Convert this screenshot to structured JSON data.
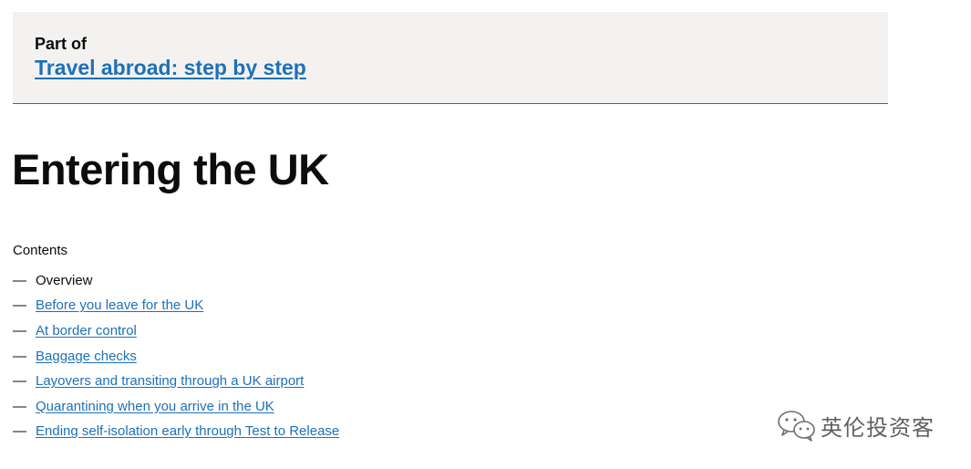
{
  "part_of": {
    "label": "Part of",
    "link_text": "Travel abroad: step by step"
  },
  "title": "Entering the UK",
  "contents": {
    "heading": "Contents",
    "dash": "—",
    "items": [
      {
        "label": "Overview",
        "current": true
      },
      {
        "label": "Before you leave for the UK",
        "current": false
      },
      {
        "label": "At border control",
        "current": false
      },
      {
        "label": "Baggage checks",
        "current": false
      },
      {
        "label": "Layovers and transiting through a UK airport",
        "current": false
      },
      {
        "label": "Quarantining when you arrive in the UK",
        "current": false
      },
      {
        "label": "Ending self-isolation early through Test to Release",
        "current": false
      }
    ]
  },
  "watermark": {
    "text": "英伦投资客",
    "icon": "wechat-icon"
  },
  "colors": {
    "link": "#1d70b8",
    "text": "#0b0c0c",
    "panel_background": "#f3f2f1"
  }
}
